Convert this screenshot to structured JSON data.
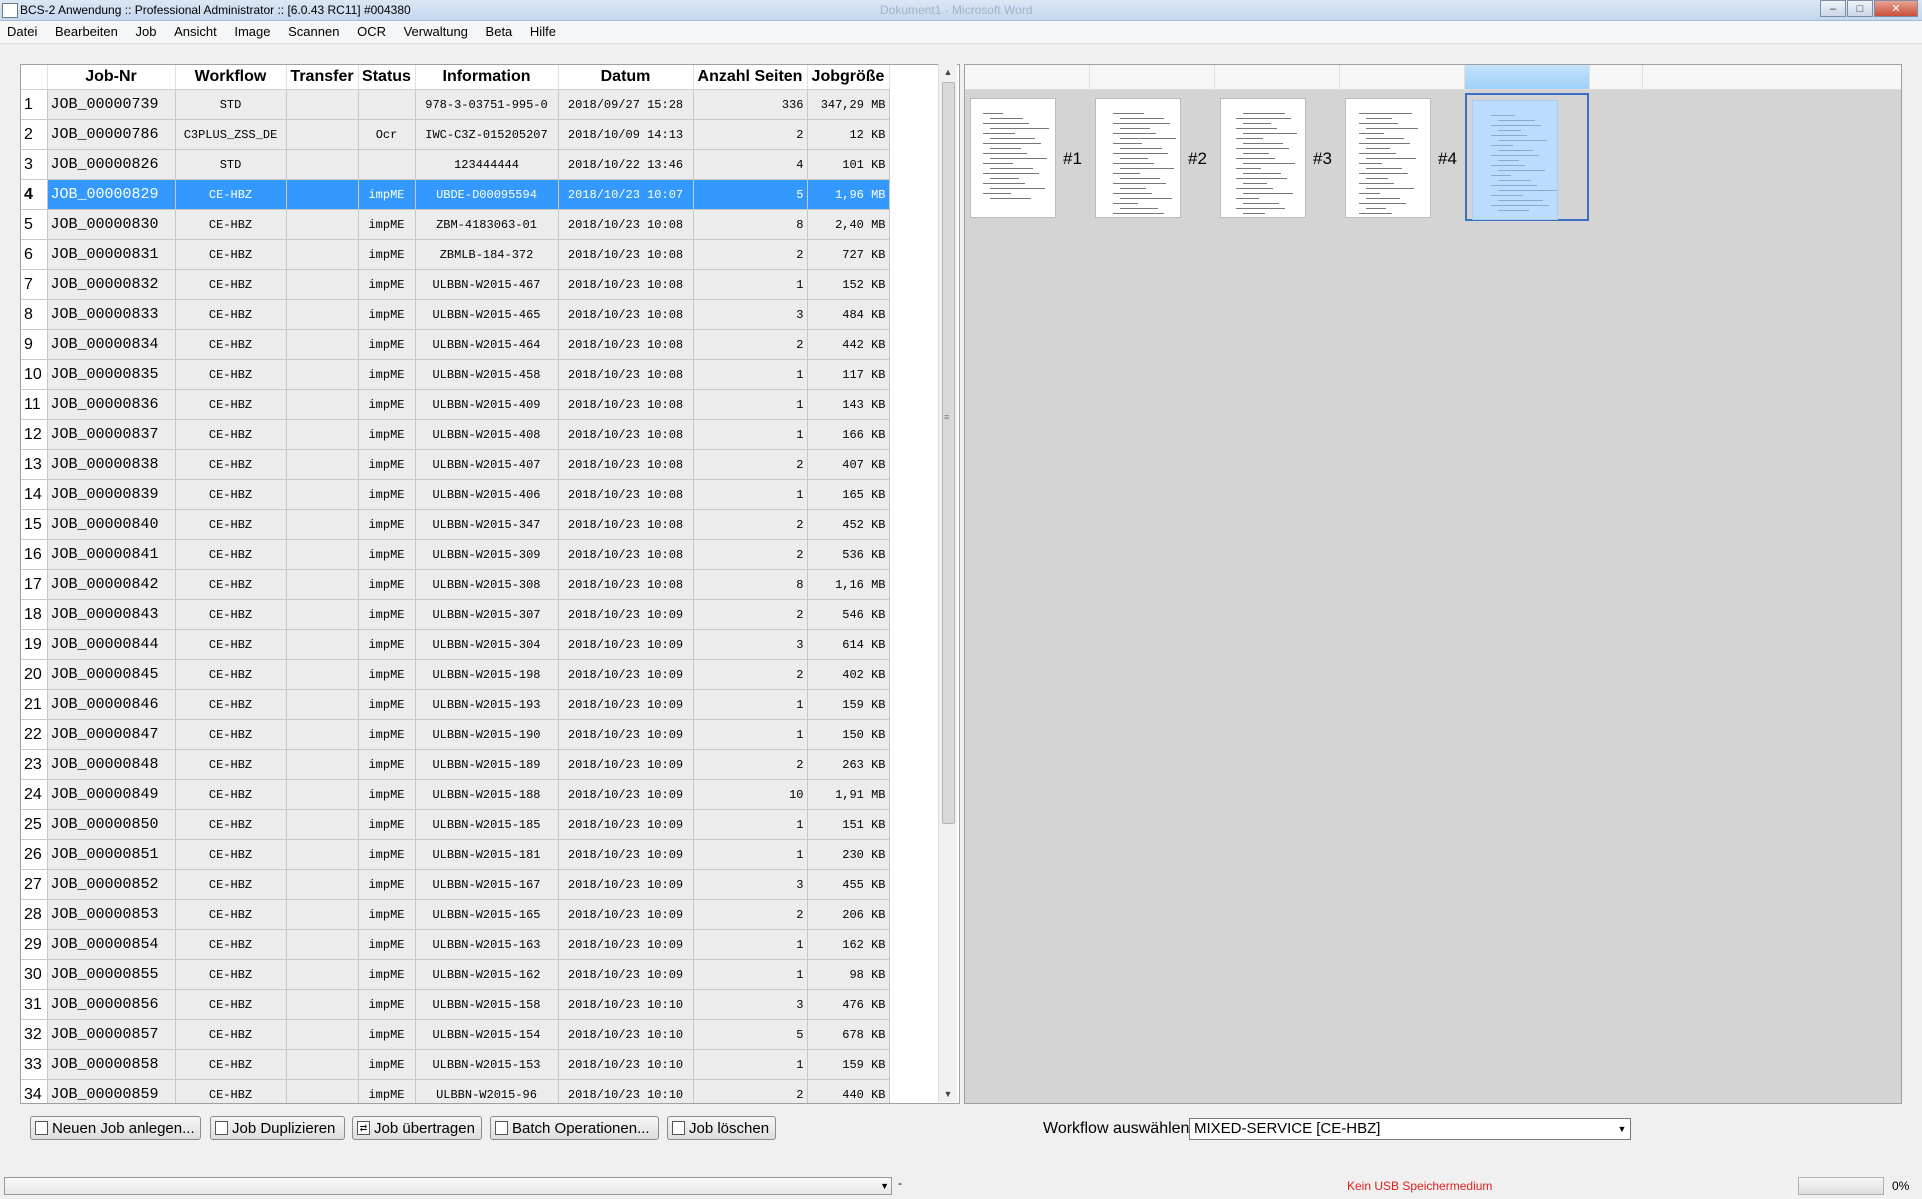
{
  "window": {
    "title": "BCS-2 Anwendung :: Professional Administrator :: [6.0.43 RC11]   #004380",
    "ghost_title": "Dokument1 - Microsoft Word",
    "controls": [
      "–",
      "□",
      "✕"
    ]
  },
  "menu": [
    "Datei",
    "Bearbeiten",
    "Job",
    "Ansicht",
    "Image",
    "Scannen",
    "OCR",
    "Verwaltung",
    "Beta",
    "Hilfe"
  ],
  "table": {
    "columns": [
      "Job-Nr",
      "Workflow",
      "Transfer",
      "Status",
      "Information",
      "Datum",
      "Anzahl Seiten",
      "Jobgröße"
    ],
    "selected_row": 3,
    "rows": [
      [
        "1",
        "JOB_00000739",
        "STD",
        "",
        "",
        "978-3-03751-995-0",
        "2018/09/27 15:28",
        "336",
        "347,29 MB"
      ],
      [
        "2",
        "JOB_00000786",
        "C3PLUS_ZSS_DE",
        "",
        "Ocr",
        "IWC-C3Z-015205207",
        "2018/10/09 14:13",
        "2",
        "12 KB"
      ],
      [
        "3",
        "JOB_00000826",
        "STD",
        "",
        "",
        "123444444",
        "2018/10/22 13:46",
        "4",
        "101 KB"
      ],
      [
        "4",
        "JOB_00000829",
        "CE-HBZ",
        "",
        "impME",
        "UBDE-D00095594",
        "2018/10/23 10:07",
        "5",
        "1,96 MB"
      ],
      [
        "5",
        "JOB_00000830",
        "CE-HBZ",
        "",
        "impME",
        "ZBM-4183063-01",
        "2018/10/23 10:08",
        "8",
        "2,40 MB"
      ],
      [
        "6",
        "JOB_00000831",
        "CE-HBZ",
        "",
        "impME",
        "ZBMLB-184-372",
        "2018/10/23 10:08",
        "2",
        "727 KB"
      ],
      [
        "7",
        "JOB_00000832",
        "CE-HBZ",
        "",
        "impME",
        "ULBBN-W2015-467",
        "2018/10/23 10:08",
        "1",
        "152 KB"
      ],
      [
        "8",
        "JOB_00000833",
        "CE-HBZ",
        "",
        "impME",
        "ULBBN-W2015-465",
        "2018/10/23 10:08",
        "3",
        "484 KB"
      ],
      [
        "9",
        "JOB_00000834",
        "CE-HBZ",
        "",
        "impME",
        "ULBBN-W2015-464",
        "2018/10/23 10:08",
        "2",
        "442 KB"
      ],
      [
        "10",
        "JOB_00000835",
        "CE-HBZ",
        "",
        "impME",
        "ULBBN-W2015-458",
        "2018/10/23 10:08",
        "1",
        "117 KB"
      ],
      [
        "11",
        "JOB_00000836",
        "CE-HBZ",
        "",
        "impME",
        "ULBBN-W2015-409",
        "2018/10/23 10:08",
        "1",
        "143 KB"
      ],
      [
        "12",
        "JOB_00000837",
        "CE-HBZ",
        "",
        "impME",
        "ULBBN-W2015-408",
        "2018/10/23 10:08",
        "1",
        "166 KB"
      ],
      [
        "13",
        "JOB_00000838",
        "CE-HBZ",
        "",
        "impME",
        "ULBBN-W2015-407",
        "2018/10/23 10:08",
        "2",
        "407 KB"
      ],
      [
        "14",
        "JOB_00000839",
        "CE-HBZ",
        "",
        "impME",
        "ULBBN-W2015-406",
        "2018/10/23 10:08",
        "1",
        "165 KB"
      ],
      [
        "15",
        "JOB_00000840",
        "CE-HBZ",
        "",
        "impME",
        "ULBBN-W2015-347",
        "2018/10/23 10:08",
        "2",
        "452 KB"
      ],
      [
        "16",
        "JOB_00000841",
        "CE-HBZ",
        "",
        "impME",
        "ULBBN-W2015-309",
        "2018/10/23 10:08",
        "2",
        "536 KB"
      ],
      [
        "17",
        "JOB_00000842",
        "CE-HBZ",
        "",
        "impME",
        "ULBBN-W2015-308",
        "2018/10/23 10:08",
        "8",
        "1,16 MB"
      ],
      [
        "18",
        "JOB_00000843",
        "CE-HBZ",
        "",
        "impME",
        "ULBBN-W2015-307",
        "2018/10/23 10:09",
        "2",
        "546 KB"
      ],
      [
        "19",
        "JOB_00000844",
        "CE-HBZ",
        "",
        "impME",
        "ULBBN-W2015-304",
        "2018/10/23 10:09",
        "3",
        "614 KB"
      ],
      [
        "20",
        "JOB_00000845",
        "CE-HBZ",
        "",
        "impME",
        "ULBBN-W2015-198",
        "2018/10/23 10:09",
        "2",
        "402 KB"
      ],
      [
        "21",
        "JOB_00000846",
        "CE-HBZ",
        "",
        "impME",
        "ULBBN-W2015-193",
        "2018/10/23 10:09",
        "1",
        "159 KB"
      ],
      [
        "22",
        "JOB_00000847",
        "CE-HBZ",
        "",
        "impME",
        "ULBBN-W2015-190",
        "2018/10/23 10:09",
        "1",
        "150 KB"
      ],
      [
        "23",
        "JOB_00000848",
        "CE-HBZ",
        "",
        "impME",
        "ULBBN-W2015-189",
        "2018/10/23 10:09",
        "2",
        "263 KB"
      ],
      [
        "24",
        "JOB_00000849",
        "CE-HBZ",
        "",
        "impME",
        "ULBBN-W2015-188",
        "2018/10/23 10:09",
        "10",
        "1,91 MB"
      ],
      [
        "25",
        "JOB_00000850",
        "CE-HBZ",
        "",
        "impME",
        "ULBBN-W2015-185",
        "2018/10/23 10:09",
        "1",
        "151 KB"
      ],
      [
        "26",
        "JOB_00000851",
        "CE-HBZ",
        "",
        "impME",
        "ULBBN-W2015-181",
        "2018/10/23 10:09",
        "1",
        "230 KB"
      ],
      [
        "27",
        "JOB_00000852",
        "CE-HBZ",
        "",
        "impME",
        "ULBBN-W2015-167",
        "2018/10/23 10:09",
        "3",
        "455 KB"
      ],
      [
        "28",
        "JOB_00000853",
        "CE-HBZ",
        "",
        "impME",
        "ULBBN-W2015-165",
        "2018/10/23 10:09",
        "2",
        "206 KB"
      ],
      [
        "29",
        "JOB_00000854",
        "CE-HBZ",
        "",
        "impME",
        "ULBBN-W2015-163",
        "2018/10/23 10:09",
        "1",
        "162 KB"
      ],
      [
        "30",
        "JOB_00000855",
        "CE-HBZ",
        "",
        "impME",
        "ULBBN-W2015-162",
        "2018/10/23 10:09",
        "1",
        "98 KB"
      ],
      [
        "31",
        "JOB_00000856",
        "CE-HBZ",
        "",
        "impME",
        "ULBBN-W2015-158",
        "2018/10/23 10:10",
        "3",
        "476 KB"
      ],
      [
        "32",
        "JOB_00000857",
        "CE-HBZ",
        "",
        "impME",
        "ULBBN-W2015-154",
        "2018/10/23 10:10",
        "5",
        "678 KB"
      ],
      [
        "33",
        "JOB_00000858",
        "CE-HBZ",
        "",
        "impME",
        "ULBBN-W2015-153",
        "2018/10/23 10:10",
        "1",
        "159 KB"
      ],
      [
        "34",
        "JOB_00000859",
        "CE-HBZ",
        "",
        "impME",
        "ULBBN-W2015-96",
        "2018/10/23 10:10",
        "2",
        "440 KB"
      ]
    ]
  },
  "thumbnails": {
    "labels": [
      "#1",
      "#2",
      "#3",
      "#4"
    ],
    "selected_index": 4
  },
  "buttons": {
    "new_job": "Neuen Job anlegen...",
    "duplicate": "Job Duplizieren",
    "transfer": "Job übertragen",
    "batch": "Batch Operationen...",
    "delete": "Job löschen"
  },
  "workflow": {
    "label": "Workflow auswählen",
    "selected": "MIXED-SERVICE [CE-HBZ]"
  },
  "status": {
    "dash": "-",
    "usb": "Kein USB Speichermedium",
    "progress_percent": "0%",
    "progress_value": 0
  },
  "colors": {
    "selection": "#3399ff",
    "usb_warning": "#e02020"
  }
}
